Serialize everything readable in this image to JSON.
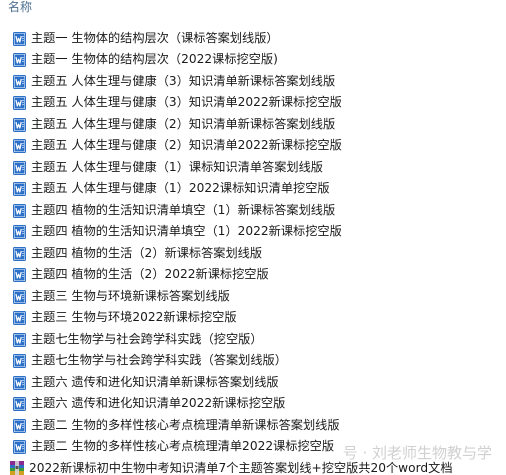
{
  "header": {
    "column_name": "名称"
  },
  "files": [
    {
      "name": "主题一 生物体的结构层次（课标答案划线版）",
      "icon": "word-doc-icon"
    },
    {
      "name": "主题一 生物体的结构层次（2022课标挖空版)",
      "icon": "word-doc-icon"
    },
    {
      "name": "主题五 人体生理与健康（3）知识清单新课标答案划线版",
      "icon": "word-doc-icon"
    },
    {
      "name": "主题五 人体生理与健康（3）知识清单2022新课标挖空版",
      "icon": "word-doc-icon"
    },
    {
      "name": "主题五 人体生理与健康（2）知识清单新课标答案划线版",
      "icon": "word-doc-icon"
    },
    {
      "name": "主题五 人体生理与健康（2）知识清单2022新课标挖空版",
      "icon": "word-doc-icon"
    },
    {
      "name": "主题五 人体生理与健康（1）课标知识清单答案划线版",
      "icon": "word-doc-icon"
    },
    {
      "name": "主题五 人体生理与健康（1）2022课标知识清单挖空版",
      "icon": "word-doc-icon"
    },
    {
      "name": "主题四 植物的生活知识清单填空（1）新课标答案划线版",
      "icon": "word-doc-icon"
    },
    {
      "name": "主题四 植物的生活知识清单填空（1）2022新课标挖空版",
      "icon": "word-doc-icon"
    },
    {
      "name": "主题四 植物的生活（2）新课标答案划线版",
      "icon": "word-doc-icon"
    },
    {
      "name": "主题四 植物的生活（2）2022新课标挖空版",
      "icon": "word-doc-icon"
    },
    {
      "name": "主题三 生物与环境新课标答案划线版",
      "icon": "word-doc-icon"
    },
    {
      "name": "主题三 生物与环境2022新课标挖空版",
      "icon": "word-doc-icon"
    },
    {
      "name": "主题七生物学与社会跨学科实践（挖空版）",
      "icon": "word-doc-icon"
    },
    {
      "name": "主题七生物学与社会跨学科实践（答案划线版）",
      "icon": "word-doc-icon"
    },
    {
      "name": "主题六 遗传和进化知识清单新课标答案划线版",
      "icon": "word-doc-icon"
    },
    {
      "name": "主题六 遗传和进化知识清单2022新课标挖空版",
      "icon": "word-doc-icon"
    },
    {
      "name": "主题二 生物的多样性核心考点梳理清单新课标答案划线版",
      "icon": "word-doc-icon"
    },
    {
      "name": "主题二 生物的多样性核心考点梳理清单2022课标挖空版",
      "icon": "word-doc-icon"
    },
    {
      "name": "2022新课标初中生物中考知识清单7个主题答案划线+挖空版共20个word文档",
      "icon": "archive-icon"
    }
  ],
  "watermark": "号 · 刘老师生物教与学",
  "colors": {
    "word_blue": "#2b6fc7",
    "header_text": "#4d6f8f"
  }
}
